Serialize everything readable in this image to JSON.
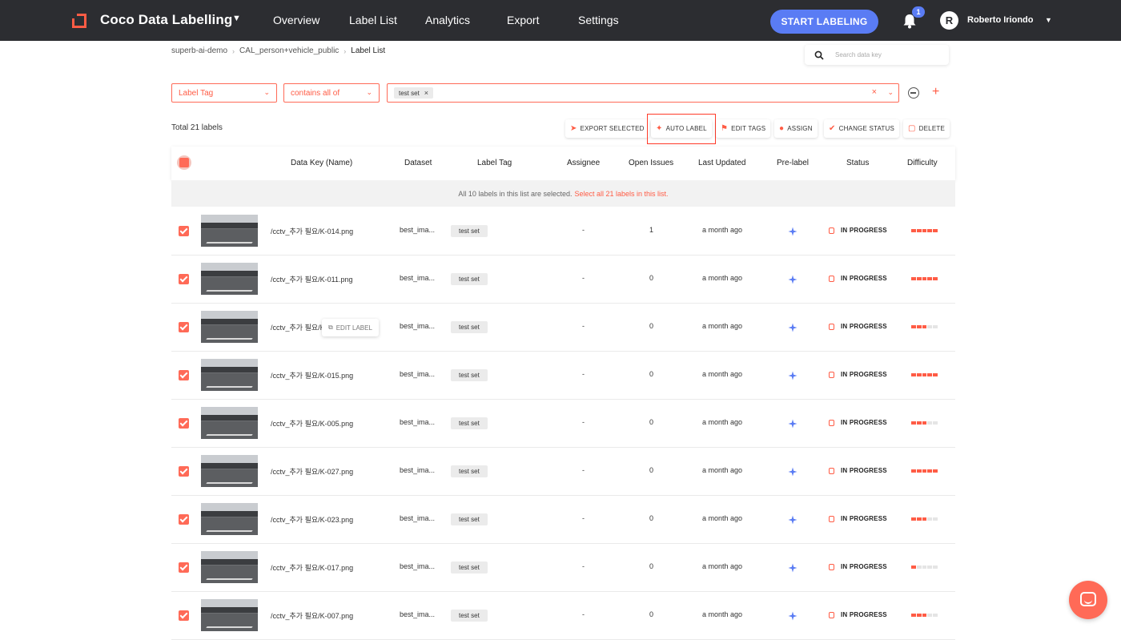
{
  "header": {
    "project_title": "Coco Data Labelling",
    "nav": [
      "Overview",
      "Label List",
      "Analytics",
      "Export",
      "Settings"
    ],
    "start_button": "START LABELING",
    "notification_count": "1",
    "avatar_initial": "R",
    "user_name": "Roberto Iriondo"
  },
  "breadcrumb": [
    "superb-ai-demo",
    "CAL_person+vehicle_public",
    "Label List"
  ],
  "search": {
    "placeholder": "Search data key"
  },
  "filter": {
    "field": "Label Tag",
    "operator": "contains all of",
    "chips": [
      "test set"
    ]
  },
  "total_text": "Total 21 labels",
  "actions": {
    "export": "EXPORT SELECTED",
    "auto_label": "AUTO LABEL",
    "edit_tags": "EDIT TAGS",
    "assign": "ASSIGN",
    "change_status": "CHANGE STATUS",
    "delete": "DELETE"
  },
  "columns": {
    "data_key": "Data Key (Name)",
    "dataset": "Dataset",
    "label_tag": "Label Tag",
    "assignee": "Assignee",
    "open_issues": "Open Issues",
    "last_updated": "Last Updated",
    "prelabel": "Pre-label",
    "status": "Status",
    "difficulty": "Difficulty"
  },
  "selection_banner": {
    "text": "All 10 labels in this list are selected.",
    "link": "Select all 21 labels in this list."
  },
  "edit_label_button": "EDIT LABEL",
  "rows": [
    {
      "key": "/cctv_추가 필요/K-014.png",
      "dataset": "best_ima...",
      "tag": "test set",
      "assignee": "-",
      "issues": "1",
      "updated": "a month ago",
      "status": "IN PROGRESS",
      "difficulty": 1.0
    },
    {
      "key": "/cctv_추가 필요/K-011.png",
      "dataset": "best_ima...",
      "tag": "test set",
      "assignee": "-",
      "issues": "0",
      "updated": "a month ago",
      "status": "IN PROGRESS",
      "difficulty": 1.0
    },
    {
      "key": "/cctv_추가 필요/K-010.png",
      "dataset": "best_ima...",
      "tag": "test set",
      "assignee": "-",
      "issues": "0",
      "updated": "a month ago",
      "status": "IN PROGRESS",
      "difficulty": 0.6
    },
    {
      "key": "/cctv_추가 필요/K-015.png",
      "dataset": "best_ima...",
      "tag": "test set",
      "assignee": "-",
      "issues": "0",
      "updated": "a month ago",
      "status": "IN PROGRESS",
      "difficulty": 1.0
    },
    {
      "key": "/cctv_추가 필요/K-005.png",
      "dataset": "best_ima...",
      "tag": "test set",
      "assignee": "-",
      "issues": "0",
      "updated": "a month ago",
      "status": "IN PROGRESS",
      "difficulty": 0.6
    },
    {
      "key": "/cctv_추가 필요/K-027.png",
      "dataset": "best_ima...",
      "tag": "test set",
      "assignee": "-",
      "issues": "0",
      "updated": "a month ago",
      "status": "IN PROGRESS",
      "difficulty": 1.0
    },
    {
      "key": "/cctv_추가 필요/K-023.png",
      "dataset": "best_ima...",
      "tag": "test set",
      "assignee": "-",
      "issues": "0",
      "updated": "a month ago",
      "status": "IN PROGRESS",
      "difficulty": 0.6
    },
    {
      "key": "/cctv_추가 필요/K-017.png",
      "dataset": "best_ima...",
      "tag": "test set",
      "assignee": "-",
      "issues": "0",
      "updated": "a month ago",
      "status": "IN PROGRESS",
      "difficulty": 0.2
    },
    {
      "key": "/cctv_추가 필요/K-007.png",
      "dataset": "best_ima...",
      "tag": "test set",
      "assignee": "-",
      "issues": "0",
      "updated": "a month ago",
      "status": "IN PROGRESS",
      "difficulty": 0.6
    }
  ],
  "colors": {
    "accent": "#ff5c45",
    "topbar": "#2c2d31",
    "primary_button": "#5a7cf4"
  }
}
